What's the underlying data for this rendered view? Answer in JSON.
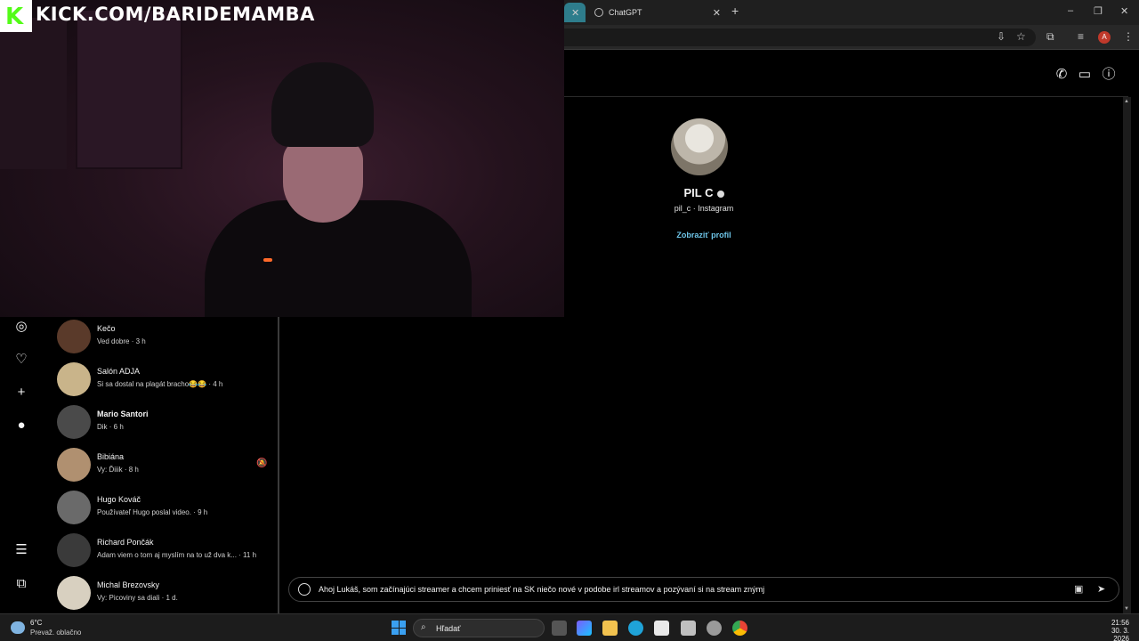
{
  "stream_overlay": {
    "brand_letter": "K",
    "url": "KICK.COM/BARIDEMAMBA"
  },
  "browser": {
    "tabs": [
      {
        "label": "ChatGPT"
      }
    ],
    "new_tab": "+",
    "window_controls": [
      "–",
      "❐",
      "✕"
    ],
    "profile_initial": "A"
  },
  "dm_header": {
    "icons": [
      "phone-icon",
      "video-icon",
      "info-icon"
    ]
  },
  "profile": {
    "name": "PIL C",
    "subtitle": "pil_c · Instagram",
    "view_profile": "Zobraziť profil"
  },
  "chats": [
    {
      "name": "Kečo",
      "preview": "Ved dobre · 3 h",
      "bold": false,
      "color": "#5a3a2a"
    },
    {
      "name": "Salón ADJA",
      "preview": "Si sa dostal na plagát bracho😂😂 · 4 h",
      "bold": false,
      "color": "#c9b48a"
    },
    {
      "name": "Mario Santori",
      "preview": "Dik · 6 h",
      "bold": true,
      "color": "#4a4a4a"
    },
    {
      "name": "Bibiána",
      "preview": "Vy: Ďiiik · 8 h",
      "bold": false,
      "color": "#b09070"
    },
    {
      "name": "Hugo Kováč",
      "preview": "Používateľ Hugo poslal video. · 9 h",
      "bold": false,
      "color": "#6a6a6a"
    },
    {
      "name": "Richard Pončák",
      "preview": "Adam viem o tom aj myslím na to už dva k... · 11 h",
      "bold": false,
      "color": "#3a3a3a"
    },
    {
      "name": "Michal Brezovsky",
      "preview": "Vy: Picoviny sa diali · 1 d.",
      "bold": false,
      "color": "#d8d0c0"
    }
  ],
  "composer": {
    "text": "Ahoj Lukáš, som začínajúci streamer a chcem priniesť na SK niečo nové v podobe irl streamov a pozývaní si na stream znýmj"
  },
  "taskbar": {
    "temperature": "6°C",
    "condition": "Prevaž. oblačno",
    "search_label": "Hľadať",
    "time": "21:56",
    "date": "30. 3. 2026"
  },
  "colors": {
    "accent_link": "#6ec5e8",
    "kick_green": "#53fc18",
    "active_tab": "#2e7d8c"
  }
}
